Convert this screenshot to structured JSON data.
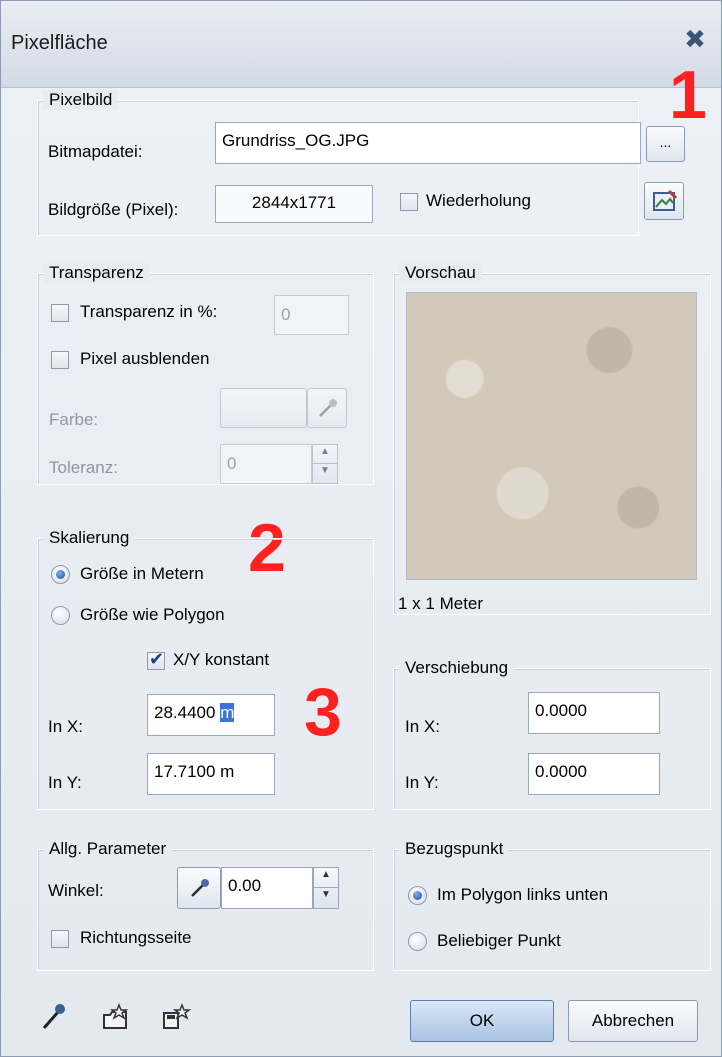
{
  "window": {
    "title": "Pixelfläche"
  },
  "annotations": [
    "1",
    "2",
    "3"
  ],
  "pixelbild": {
    "group_label": "Pixelbild",
    "bitmap_label": "Bitmapdatei:",
    "bitmap_value": "Grundriss_OG.JPG",
    "browse_label": "...",
    "size_label": "Bildgröße (Pixel):",
    "size_value": "2844x1771",
    "repeat_label": "Wiederholung",
    "repeat_checked": false
  },
  "transparenz": {
    "group_label": "Transparenz",
    "percent_label": "Transparenz in %:",
    "percent_value": "0",
    "hide_label": "Pixel ausblenden",
    "color_label": "Farbe:",
    "tolerance_label": "Toleranz:",
    "tolerance_value": "0"
  },
  "vorschau": {
    "group_label": "Vorschau",
    "caption": "1 x 1 Meter"
  },
  "skalierung": {
    "group_label": "Skalierung",
    "opt_meters": "Größe in Metern",
    "opt_polygon": "Größe wie Polygon",
    "selected": "meters",
    "xy_const_label": "X/Y konstant",
    "xy_const_checked": true,
    "x_label": "In X:",
    "x_value_number": "28.4400 ",
    "x_value_unit": "m",
    "y_label": "In Y:",
    "y_value": "17.7100 m"
  },
  "verschiebung": {
    "group_label": "Verschiebung",
    "x_label": "In X:",
    "x_value": "0.0000",
    "y_label": "In Y:",
    "y_value": "0.0000"
  },
  "allg": {
    "group_label": "Allg. Parameter",
    "angle_label": "Winkel:",
    "angle_value": "0.00",
    "direction_label": "Richtungsseite"
  },
  "bezugspunkt": {
    "group_label": "Bezugspunkt",
    "opt_bottom_left": "Im Polygon links unten",
    "opt_any": "Beliebiger Punkt",
    "selected": "bottom_left"
  },
  "footer": {
    "ok_label": "OK",
    "cancel_label": "Abbrechen"
  },
  "colors": {
    "annotation": "#ff2020",
    "accent": "#1f4f9e"
  }
}
